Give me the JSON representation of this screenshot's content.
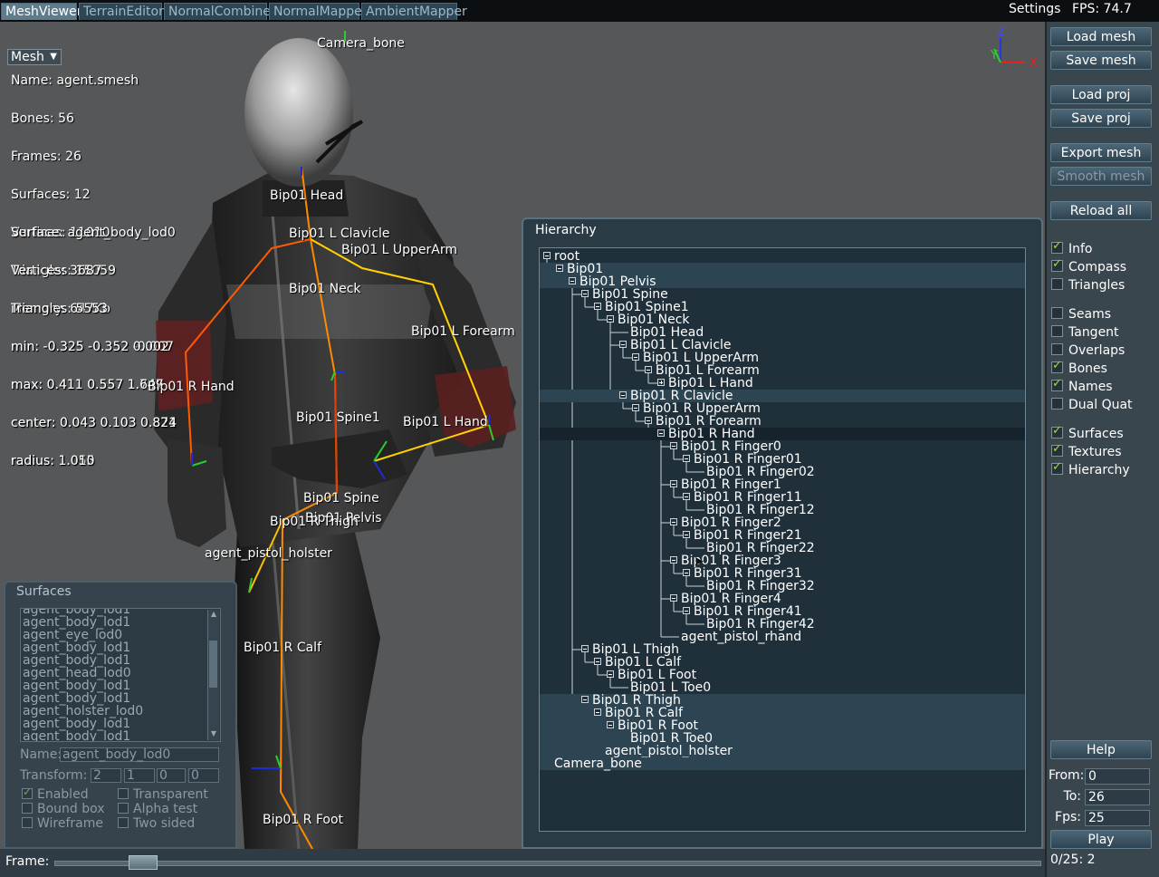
{
  "tabs": [
    {
      "label": "MeshViewer",
      "active": true
    },
    {
      "label": "TerrainEditor",
      "active": false
    },
    {
      "label": "NormalCombiner",
      "active": false
    },
    {
      "label": "NormalMapper",
      "active": false
    },
    {
      "label": "AmbientMapper",
      "active": false
    }
  ],
  "topbar": {
    "settings": "Settings",
    "fps": "FPS: 74.7"
  },
  "viewport": {
    "mode_select": "Mesh",
    "mesh_info": [
      "Name: agent.smesh",
      "Bones: 56",
      "Frames: 26",
      "Surfaces: 12",
      "Vertices: 11010",
      "Triangles: 15059",
      "Memory: 647Kb",
      "min: -0.325 -0.352 -0.007",
      "max: 0.411 0.557 1.749",
      "center: 0.043 0.103 0.871",
      "radius: 1.055"
    ],
    "surface_info": [
      "Surface: agent_body_lod0",
      "Vertices: 3687",
      "Triangles: 5553",
      "min: -0.325 -0.352 0.002",
      "max: 0.411 0.557 1.647",
      "center: 0.043 0.103 0.824",
      "radius: 1.010"
    ],
    "compass": {
      "x": "X",
      "y": "Y",
      "z": "Z"
    },
    "bone_labels": {
      "camera": "Camera_bone",
      "head": "Bip01 Head",
      "lclav": "Bip01 L Clavicle",
      "luparm": "Bip01 L UpperArm",
      "neck": "Bip01 Neck",
      "lforearm": "Bip01 L Forearm",
      "rhand": "Bip01 R Hand",
      "spine1": "Bip01 Spine1",
      "lhand": "Bip01 L Hand",
      "spine": "Bip01 Spine",
      "pelvis": "Bip01 Pelvis",
      "rthigh": "Bip01 R Thigh",
      "holster": "agent_pistol_holster",
      "rcalf": "Bip01 R Calf",
      "rfoot": "Bip01 R Foot"
    }
  },
  "right_panel": {
    "buttons": {
      "load_mesh": "Load mesh",
      "save_mesh": "Save mesh",
      "load_proj": "Load proj",
      "save_proj": "Save proj",
      "export_mesh": "Export mesh",
      "smooth_mesh": "Smooth mesh",
      "reload_all": "Reload all",
      "help": "Help",
      "play": "Play"
    },
    "checkboxes": [
      {
        "label": "Info",
        "checked": true
      },
      {
        "label": "Compass",
        "checked": true
      },
      {
        "label": "Triangles",
        "checked": false
      },
      {
        "label": "Seams",
        "checked": false
      },
      {
        "label": "Tangent",
        "checked": false
      },
      {
        "label": "Overlaps",
        "checked": false
      },
      {
        "label": "Bones",
        "checked": true
      },
      {
        "label": "Names",
        "checked": true
      },
      {
        "label": "Dual Quat",
        "checked": false
      },
      {
        "label": "Surfaces",
        "checked": true
      },
      {
        "label": "Textures",
        "checked": true
      },
      {
        "label": "Hierarchy",
        "checked": true
      }
    ],
    "from_label": "From:",
    "from_value": "0",
    "to_label": "To:",
    "to_value": "26",
    "fps_label": "Fps:",
    "fps_value": "25",
    "frame_counter": "0/25: 2"
  },
  "hierarchy": {
    "title": "Hierarchy",
    "nodes": [
      {
        "label": "root",
        "depth": 0,
        "toggle": "minus"
      },
      {
        "label": "Bip01",
        "depth": 1,
        "toggle": "minus"
      },
      {
        "label": "Bip01 Pelvis",
        "depth": 2,
        "toggle": "minus"
      },
      {
        "label": "Bip01 Spine",
        "depth": 3,
        "toggle": "minus"
      },
      {
        "label": "Bip01 Spine1",
        "depth": 4,
        "toggle": "minus"
      },
      {
        "label": "Bip01 Neck",
        "depth": 5,
        "toggle": "minus"
      },
      {
        "label": "Bip01 Head",
        "depth": 6,
        "toggle": ""
      },
      {
        "label": "Bip01 L Clavicle",
        "depth": 6,
        "toggle": "minus"
      },
      {
        "label": "Bip01 L UpperArm",
        "depth": 7,
        "toggle": "minus"
      },
      {
        "label": "Bip01 L Forearm",
        "depth": 8,
        "toggle": "minus"
      },
      {
        "label": "Bip01 L Hand",
        "depth": 9,
        "toggle": "plus"
      },
      {
        "label": "Bip01 R Clavicle",
        "depth": 6,
        "toggle": "minus"
      },
      {
        "label": "Bip01 R UpperArm",
        "depth": 7,
        "toggle": "minus"
      },
      {
        "label": "Bip01 R Forearm",
        "depth": 8,
        "toggle": "minus"
      },
      {
        "label": "Bip01 R Hand",
        "depth": 9,
        "toggle": "minus"
      },
      {
        "label": "Bip01 R Finger0",
        "depth": 10,
        "toggle": "minus"
      },
      {
        "label": "Bip01 R Finger01",
        "depth": 11,
        "toggle": "minus"
      },
      {
        "label": "Bip01 R Finger02",
        "depth": 12,
        "toggle": ""
      },
      {
        "label": "Bip01 R Finger1",
        "depth": 10,
        "toggle": "minus"
      },
      {
        "label": "Bip01 R Finger11",
        "depth": 11,
        "toggle": "minus"
      },
      {
        "label": "Bip01 R Finger12",
        "depth": 12,
        "toggle": ""
      },
      {
        "label": "Bip01 R Finger2",
        "depth": 10,
        "toggle": "minus"
      },
      {
        "label": "Bip01 R Finger21",
        "depth": 11,
        "toggle": "minus"
      },
      {
        "label": "Bip01 R Finger22",
        "depth": 12,
        "toggle": ""
      },
      {
        "label": "Bip01 R Finger3",
        "depth": 10,
        "toggle": "minus"
      },
      {
        "label": "Bip01 R Finger31",
        "depth": 11,
        "toggle": "minus"
      },
      {
        "label": "Bip01 R Finger32",
        "depth": 12,
        "toggle": ""
      },
      {
        "label": "Bip01 R Finger4",
        "depth": 10,
        "toggle": "minus"
      },
      {
        "label": "Bip01 R Finger41",
        "depth": 11,
        "toggle": "minus"
      },
      {
        "label": "Bip01 R Finger42",
        "depth": 12,
        "toggle": ""
      },
      {
        "label": "agent_pistol_rhand",
        "depth": 10,
        "toggle": ""
      },
      {
        "label": "Bip01 L Thigh",
        "depth": 3,
        "toggle": "minus"
      },
      {
        "label": "Bip01 L Calf",
        "depth": 4,
        "toggle": "minus"
      },
      {
        "label": "Bip01 L Foot",
        "depth": 5,
        "toggle": "minus"
      },
      {
        "label": "Bip01 L Toe0",
        "depth": 6,
        "toggle": ""
      },
      {
        "label": "Bip01 R Thigh",
        "depth": 3,
        "toggle": "minus"
      },
      {
        "label": "Bip01 R Calf",
        "depth": 4,
        "toggle": "minus"
      },
      {
        "label": "Bip01 R Foot",
        "depth": 5,
        "toggle": "minus"
      },
      {
        "label": "Bip01 R Toe0",
        "depth": 6,
        "toggle": ""
      },
      {
        "label": "agent_pistol_holster",
        "depth": 4,
        "toggle": ""
      },
      {
        "label": "Camera_bone",
        "depth": 0,
        "toggle": ""
      }
    ]
  },
  "surfaces": {
    "title": "Surfaces",
    "list": [
      "agent_body_lod1",
      "agent_body_lod1",
      "agent_eye_lod0",
      "agent_body_lod1",
      "agent_body_lod1",
      "agent_head_lod0",
      "agent_body_lod1",
      "agent_body_lod1",
      "agent_holster_lod0",
      "agent_body_lod1",
      "agent_body_lod1"
    ],
    "name_label": "Name:",
    "name_value": "agent_body_lod0",
    "transform_label": "Transform:",
    "transform_values": [
      "2",
      "1",
      "0",
      "0"
    ],
    "options": [
      {
        "label": "Enabled",
        "checked": true
      },
      {
        "label": "Transparent",
        "checked": false
      },
      {
        "label": "Bound box",
        "checked": false
      },
      {
        "label": "Alpha test",
        "checked": false
      },
      {
        "label": "Wireframe",
        "checked": false
      },
      {
        "label": "Two sided",
        "checked": false
      }
    ]
  },
  "frame_label": "Frame:"
}
